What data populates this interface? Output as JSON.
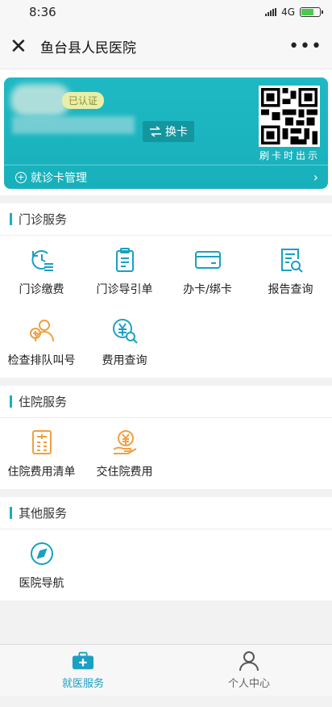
{
  "status": {
    "time": "8:36",
    "network": "4G"
  },
  "nav": {
    "title": "鱼台县人民医院",
    "close_icon": "close-icon",
    "more_icon": "more-icon"
  },
  "card": {
    "verified_label": "已认证",
    "switch_label": "换卡",
    "qr_label": "刷卡时出示",
    "manage_label": "就诊卡管理"
  },
  "sections": {
    "outpatient": {
      "title": "门诊服务",
      "items": [
        {
          "label": "门诊缴费",
          "icon": "clock-list-icon"
        },
        {
          "label": "门诊导引单",
          "icon": "clipboard-icon"
        },
        {
          "label": "办卡/绑卡",
          "icon": "card-icon"
        },
        {
          "label": "报告查询",
          "icon": "report-search-icon"
        },
        {
          "label": "检查排队叫号",
          "icon": "queue-user-icon"
        },
        {
          "label": "费用查询",
          "icon": "fee-search-icon"
        }
      ]
    },
    "inpatient": {
      "title": "住院服务",
      "items": [
        {
          "label": "住院费用清单",
          "icon": "bill-list-icon"
        },
        {
          "label": "交住院费用",
          "icon": "pay-hand-icon"
        }
      ]
    },
    "other": {
      "title": "其他服务",
      "items": [
        {
          "label": "医院导航",
          "icon": "compass-icon"
        }
      ]
    }
  },
  "tabs": [
    {
      "label": "就医服务",
      "icon": "medical-kit-icon",
      "active": true
    },
    {
      "label": "个人中心",
      "icon": "person-icon",
      "active": false
    }
  ],
  "colors": {
    "teal": "#17b0bb",
    "blue": "#1aa0c4",
    "orange": "#f0a040"
  }
}
